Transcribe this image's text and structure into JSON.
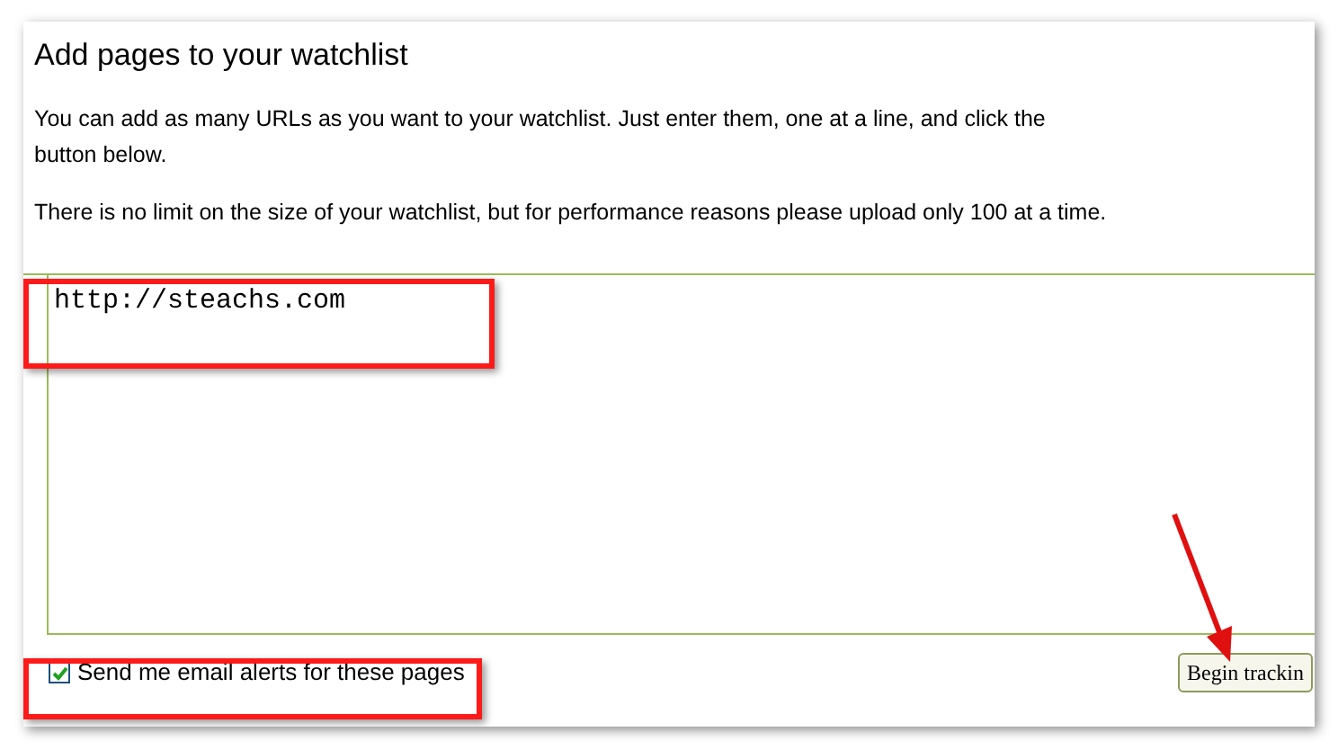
{
  "heading": "Add pages to your watchlist",
  "paragraphs": [
    "You can add as many URLs as you want to your watchlist. Just enter them, one at a line, and click the button below.",
    "There is no limit on the size of your watchlist, but for performance reasons please upload only 100 at a time."
  ],
  "url_list": {
    "value": "http://steachs.com"
  },
  "email_alerts": {
    "label": "Send me email alerts for these pages",
    "checked": true
  },
  "submit_button": {
    "label": "Begin trackin"
  }
}
